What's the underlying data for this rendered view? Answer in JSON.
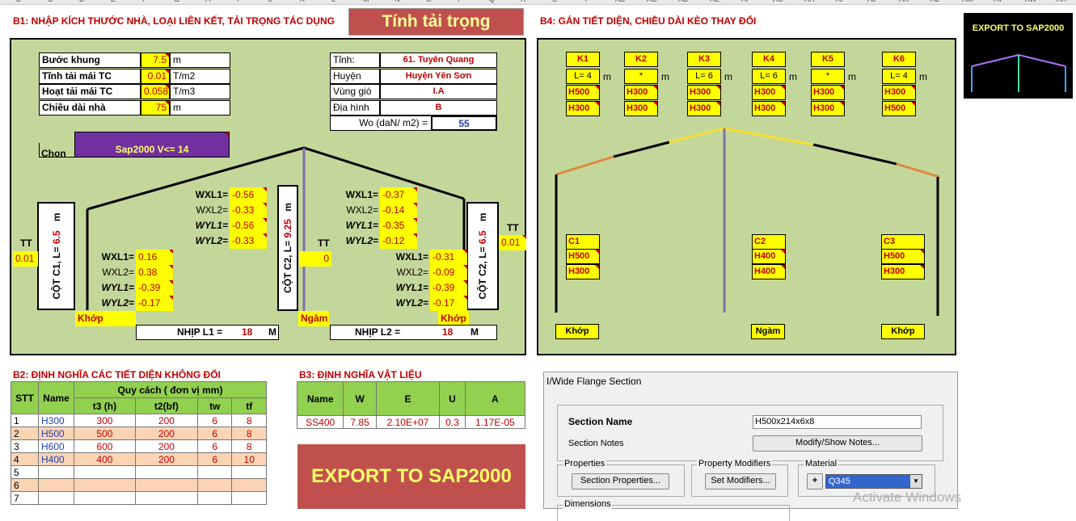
{
  "col_headers": [
    "B",
    "C",
    "D",
    "E",
    "F",
    "G",
    "H",
    "I",
    "J",
    "K",
    "L",
    "M",
    "N",
    "O",
    "P",
    "Q",
    "R",
    "S",
    "T",
    "AB",
    "AC",
    "AD",
    "AE",
    "AF",
    "AG",
    "AH",
    "AI",
    "AJ",
    "AK",
    "AL",
    "AM",
    "AV",
    "AW",
    "AX"
  ],
  "b1": {
    "title": "B1: NHẬP KÍCH THƯỚC NHÀ, LOẠI LIÊN KẾT, TẢI TRỌNG TÁC DỤNG",
    "calc_button": "Tính tải trọng",
    "params": [
      {
        "label": "Bước khung",
        "value": "7.5",
        "unit": "m"
      },
      {
        "label": "Tĩnh tải mái TC",
        "value": "0.01",
        "unit": "T/m2"
      },
      {
        "label": "Hoạt tải mái TC",
        "value": "0.058",
        "unit": "T/m3"
      },
      {
        "label": "Chiều dài nhà",
        "value": "75",
        "unit": "m"
      }
    ],
    "location": [
      {
        "label": "Tỉnh:",
        "value": "61. Tuyên Quang"
      },
      {
        "label": "Huyện",
        "value": "Huyện Yên Sơn"
      },
      {
        "label": "Vùng gió",
        "value": "I.A"
      },
      {
        "label": "Địa hình",
        "value": "B"
      }
    ],
    "wo_label": "Wo (daN/ m2) =",
    "wo_value": "55",
    "choose_label": "Chọn",
    "choose_value": "Sap2000 V<= 14",
    "col_c1": "CỘT C1, L=",
    "col_c1_val": "6.5",
    "col_c1_unit": "m",
    "col_mid": "CỘT C2, L=",
    "col_mid_val": "9.25",
    "col_mid_unit": "m",
    "col_c2": "CỘT C2, L=",
    "col_c2_val": "6.5",
    "col_c2_unit": "m",
    "tt_label": "TT",
    "tt_left": "0.01",
    "tt_mid": "0",
    "tt_right": "0.01",
    "wind_roof_left": [
      {
        "l": "WXL1=",
        "v": "-0.56"
      },
      {
        "l": "WXL2=",
        "v": "-0.33"
      },
      {
        "l": "WYL1=",
        "v": "-0.56"
      },
      {
        "l": "WYL2=",
        "v": "-0.33"
      }
    ],
    "wind_col_left": [
      {
        "l": "WXL1=",
        "v": "0.16"
      },
      {
        "l": "WXL2=",
        "v": "0.38"
      },
      {
        "l": "WYL1=",
        "v": "-0.39"
      },
      {
        "l": "WYL2=",
        "v": "-0.17"
      }
    ],
    "wind_roof_right": [
      {
        "l": "WXL1=",
        "v": "-0.37"
      },
      {
        "l": "WXL2=",
        "v": "-0.14"
      },
      {
        "l": "WYL1=",
        "v": "-0.35"
      },
      {
        "l": "WYL2=",
        "v": "-0.12"
      }
    ],
    "wind_col_right": [
      {
        "l": "WXL1=",
        "v": "-0.31"
      },
      {
        "l": "WXL2=",
        "v": "-0.09"
      },
      {
        "l": "WYL1=",
        "v": "-0.39"
      },
      {
        "l": "WYL2=",
        "v": "-0.17"
      }
    ],
    "support_left": "Khớp",
    "support_mid": "Ngàm",
    "support_right": "Khớp",
    "span1_label": "NHỊP L1 =",
    "span1_value": "18",
    "span2_label": "NHỊP L2 =",
    "span2_value": "18",
    "span_unit": "M"
  },
  "b4": {
    "title": "B4: GÁN TIẾT DIỆN, CHIỀU DÀI KÈO THAY ĐỔI",
    "rafters": [
      {
        "name": "K1",
        "len": "L= 4",
        "s1": "H500",
        "s2": "H300"
      },
      {
        "name": "K2",
        "len": "*",
        "s1": "H300",
        "s2": "H300"
      },
      {
        "name": "K3",
        "len": "L= 6",
        "s1": "H300",
        "s2": "H300"
      },
      {
        "name": "K4",
        "len": "L= 6",
        "s1": "H300",
        "s2": "H300"
      },
      {
        "name": "K5",
        "len": "*",
        "s1": "H300",
        "s2": "H300"
      },
      {
        "name": "K6",
        "len": "L= 4",
        "s1": "H300",
        "s2": "H500"
      }
    ],
    "unit": "m",
    "columns": [
      {
        "name": "C1",
        "s1": "H500",
        "s2": "H300"
      },
      {
        "name": "C2",
        "s1": "H400",
        "s2": "H400"
      },
      {
        "name": "C3",
        "s1": "H500",
        "s2": "H300"
      }
    ],
    "supports": [
      "Khớp",
      "Ngàm",
      "Khớp"
    ]
  },
  "export_logo": "EXPORT TO SAP2000",
  "b2": {
    "title": "B2: ĐỊNH NGHĨA CÁC TIẾT DIỆN KHÔNG ĐỔI",
    "h_stt": "STT",
    "h_name": "Name",
    "h_spec": "Quy cách ( đơn vị mm)",
    "h_cols": [
      "t3 (h)",
      "t2(bf)",
      "tw",
      "tf"
    ],
    "rows": [
      {
        "stt": "1",
        "name": "H300",
        "t3": "300",
        "t2": "200",
        "tw": "6",
        "tf": "8"
      },
      {
        "stt": "2",
        "name": "H500",
        "t3": "500",
        "t2": "200",
        "tw": "6",
        "tf": "8"
      },
      {
        "stt": "3",
        "name": "H600",
        "t3": "600",
        "t2": "200",
        "tw": "6",
        "tf": "8"
      },
      {
        "stt": "4",
        "name": "H400",
        "t3": "400",
        "t2": "200",
        "tw": "6",
        "tf": "10"
      },
      {
        "stt": "5",
        "name": "",
        "t3": "",
        "t2": "",
        "tw": "",
        "tf": ""
      },
      {
        "stt": "6",
        "name": "",
        "t3": "",
        "t2": "",
        "tw": "",
        "tf": ""
      },
      {
        "stt": "7",
        "name": "",
        "t3": "",
        "t2": "",
        "tw": "",
        "tf": ""
      }
    ]
  },
  "b3": {
    "title": "B3: ĐỊNH NGHĨA VẬT LIỆU",
    "headers": [
      "Name",
      "W",
      "E",
      "U",
      "A"
    ],
    "row": [
      "SS400",
      "7.85",
      "2.10E+07",
      "0.3",
      "1.17E-05"
    ]
  },
  "export_button": "EXPORT TO SAP2000",
  "dialog": {
    "title": "I/Wide Flange Section",
    "section_name_label": "Section Name",
    "section_name_value": "H500x214x6x8",
    "section_notes_label": "Section Notes",
    "modify_notes_btn": "Modify/Show Notes...",
    "properties_group": "Properties",
    "section_props_btn": "Section Properties...",
    "modifiers_group": "Property Modifiers",
    "set_modifiers_btn": "Set Modifiers...",
    "material_group": "Material",
    "material_value": "Q345",
    "dimensions_group": "Dimensions"
  },
  "watermark": "Activate Windows",
  "colors": {
    "panel": "#c4d79b",
    "yellow": "#ffff00",
    "red": "#c00000",
    "purple": "#7030a0",
    "btn": "#c0504d",
    "green": "#92d050"
  }
}
